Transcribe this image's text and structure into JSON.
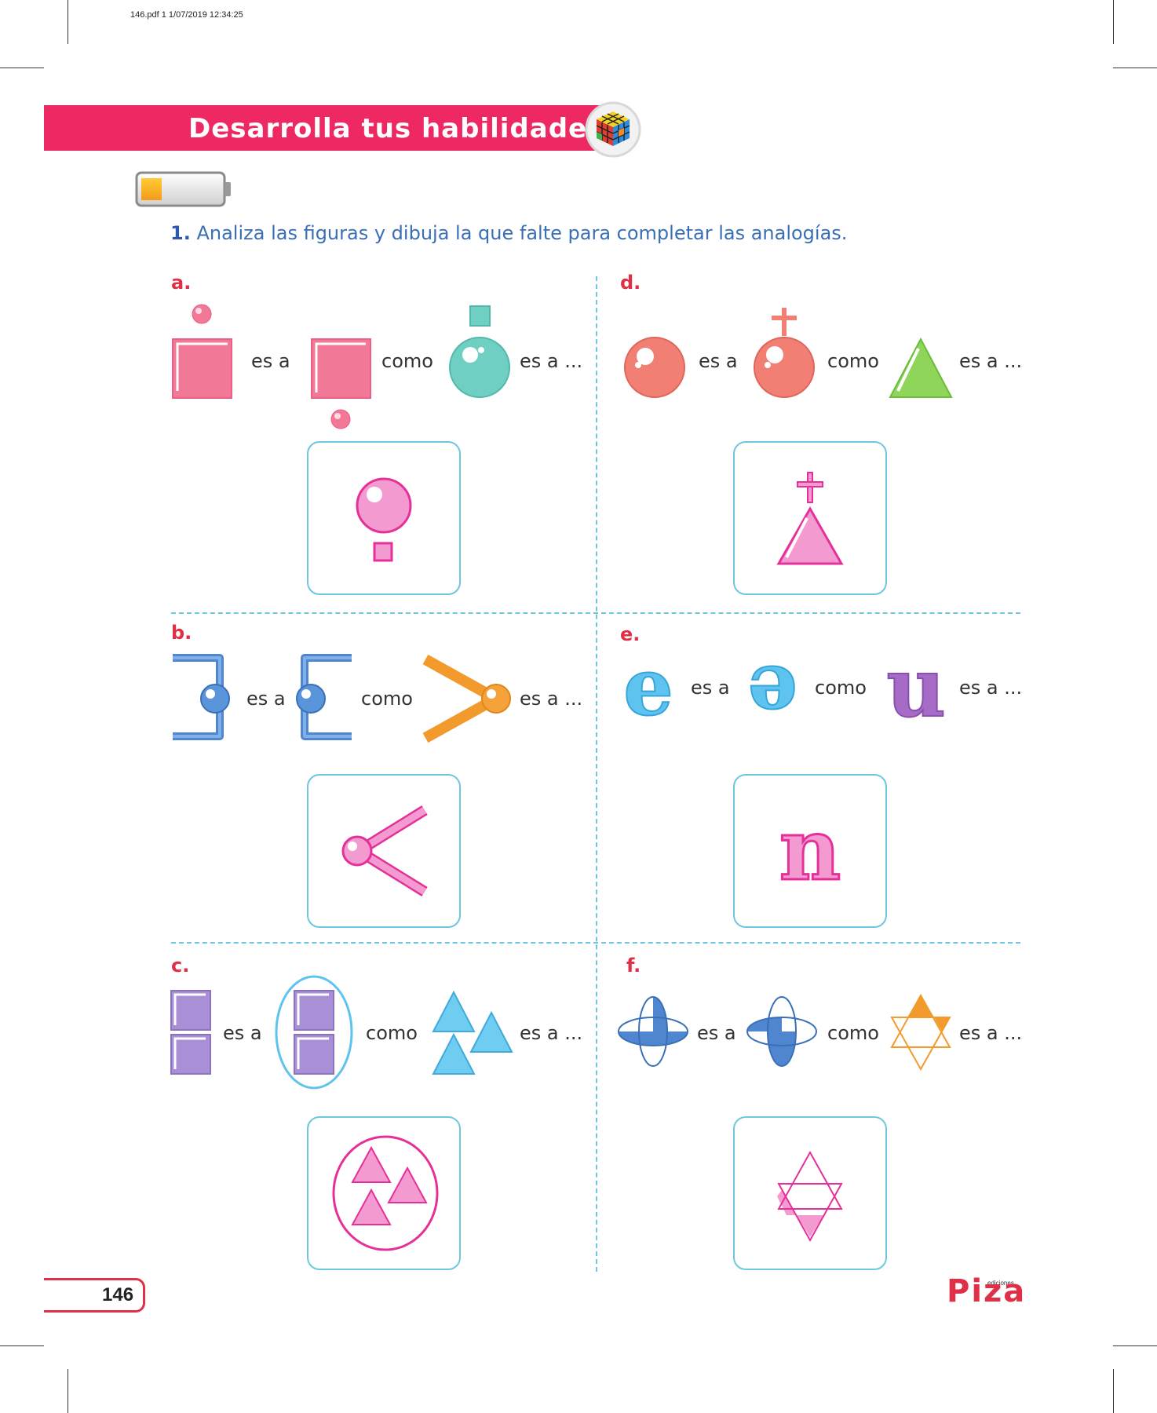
{
  "print_header": "146.pdf   1   1/07/2019   12:34:25",
  "banner_title": "Desarrolla tus habilidades",
  "instruction": {
    "number": "1.",
    "text": "Analiza las figuras y dibuja la que falte para completar las analogías."
  },
  "words": {
    "es_a": "es a",
    "como": "como",
    "es_a_end": "es a ..."
  },
  "exercises": [
    {
      "label": "a."
    },
    {
      "label": "b."
    },
    {
      "label": "c."
    },
    {
      "label": "d."
    },
    {
      "label": "e."
    },
    {
      "label": "f."
    }
  ],
  "letters": {
    "e_glyph": "e",
    "u_glyph": "u",
    "n_glyph": "n"
  },
  "page_number": "146",
  "publisher": {
    "name": "Piza",
    "tag": "ediciones"
  },
  "colors": {
    "banner": "#ee2863",
    "accent_red": "#e03047",
    "instruction_blue": "#3a6fb5",
    "box_border": "#6ec7df",
    "answer_pink": "#ee6fb9"
  }
}
